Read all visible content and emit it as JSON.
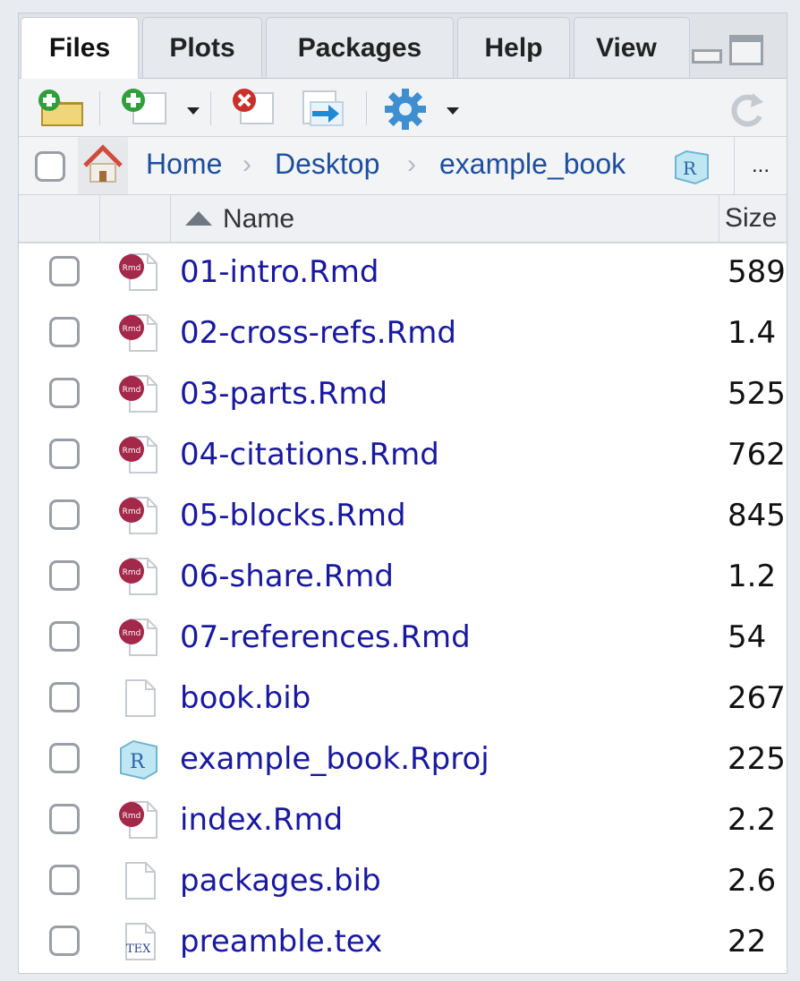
{
  "tabs": [
    {
      "label": "Files",
      "active": true
    },
    {
      "label": "Plots",
      "active": false
    },
    {
      "label": "Packages",
      "active": false
    },
    {
      "label": "Help",
      "active": false
    },
    {
      "label": "View",
      "active": false
    }
  ],
  "toolbar": {
    "icons": [
      "new-folder-icon",
      "new-file-icon",
      "delete-icon",
      "rename-icon",
      "gear-more-icon",
      "refresh-icon"
    ]
  },
  "breadcrumb": {
    "items": [
      "Home",
      "Desktop",
      "example_book"
    ],
    "more_label": "..."
  },
  "table": {
    "name_header": "Name",
    "size_header": "Size"
  },
  "files": [
    {
      "name": "01-intro.Rmd",
      "size": "589",
      "type": "rmd"
    },
    {
      "name": "02-cross-refs.Rmd",
      "size": "1.4",
      "type": "rmd"
    },
    {
      "name": "03-parts.Rmd",
      "size": "525",
      "type": "rmd"
    },
    {
      "name": "04-citations.Rmd",
      "size": "762",
      "type": "rmd"
    },
    {
      "name": "05-blocks.Rmd",
      "size": "845",
      "type": "rmd"
    },
    {
      "name": "06-share.Rmd",
      "size": "1.2",
      "type": "rmd"
    },
    {
      "name": "07-references.Rmd",
      "size": "54",
      "type": "rmd"
    },
    {
      "name": "book.bib",
      "size": "267",
      "type": "blank"
    },
    {
      "name": "example_book.Rproj",
      "size": "225",
      "type": "rproj"
    },
    {
      "name": "index.Rmd",
      "size": "2.2",
      "type": "rmd"
    },
    {
      "name": "packages.bib",
      "size": "2.6",
      "type": "blank"
    },
    {
      "name": "preamble.tex",
      "size": "22",
      "type": "tex"
    }
  ],
  "colors": {
    "link": "#1d4e9e",
    "filename": "#1919a0",
    "rmd": "#a3284a"
  }
}
